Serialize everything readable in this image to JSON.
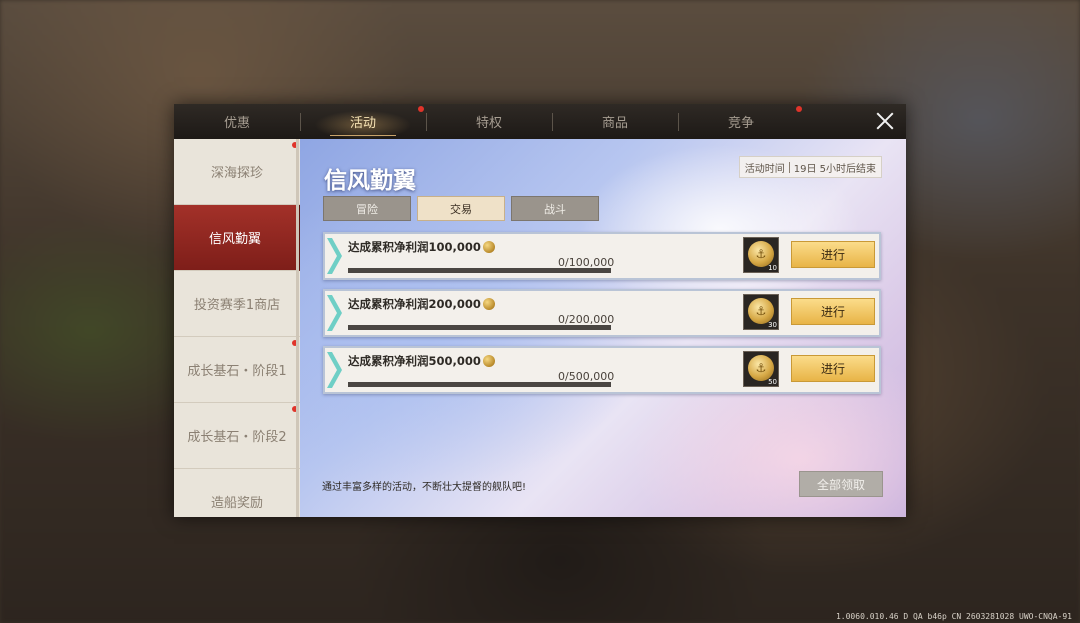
{
  "tabs": [
    {
      "label": "优惠",
      "active": false,
      "badge": false
    },
    {
      "label": "活动",
      "active": true,
      "badge": true
    },
    {
      "label": "特权",
      "active": false,
      "badge": false
    },
    {
      "label": "商品",
      "active": false,
      "badge": false
    },
    {
      "label": "竞争",
      "active": false,
      "badge": true
    }
  ],
  "sidebar": {
    "items": [
      {
        "label": "深海探珍",
        "active": false,
        "badge": true
      },
      {
        "label": "信风勤翼",
        "active": true,
        "badge": false
      },
      {
        "label": "投资赛季1商店",
        "active": false,
        "badge": false
      },
      {
        "label": "成长基石・阶段1",
        "active": false,
        "badge": true
      },
      {
        "label": "成长基石・阶段2",
        "active": false,
        "badge": true
      },
      {
        "label": "造船奖励",
        "active": false,
        "badge": false
      }
    ]
  },
  "main": {
    "title": "信风勤翼",
    "time_label": "活动时间",
    "time_value": "19日 5小时后结束",
    "subtabs": [
      {
        "label": "冒险",
        "active": false
      },
      {
        "label": "交易",
        "active": true
      },
      {
        "label": "战斗",
        "active": false
      }
    ],
    "tasks": [
      {
        "name": "达成累积净利润100,000",
        "progress": "0/100,000",
        "progress_fraction": 0,
        "reward_qty": "10",
        "button": "进行"
      },
      {
        "name": "达成累积净利润200,000",
        "progress": "0/200,000",
        "progress_fraction": 0,
        "reward_qty": "30",
        "button": "进行"
      },
      {
        "name": "达成累积净利润500,000",
        "progress": "0/500,000",
        "progress_fraction": 0,
        "reward_qty": "50",
        "button": "进行"
      }
    ],
    "footer_text": "通过丰富多样的活动，不断壮大提督的舰队吧!",
    "claim_all": "全部领取"
  },
  "version": "1.0060.010.46 D QA b46p CN 2603281028 UWO-CNQA-91",
  "colors": {
    "accent_red": "#a33129",
    "badge_red": "#e0342a",
    "button_gold": "#e8b447"
  }
}
